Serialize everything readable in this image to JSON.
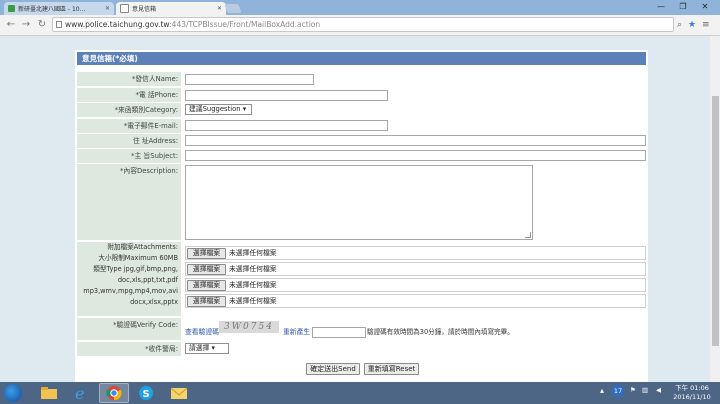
{
  "browser": {
    "tabs": [
      {
        "title": "新研臺北建八國區 - 10…",
        "active": false
      },
      {
        "title": "意見信箱",
        "active": true
      }
    ],
    "url_host": "www.police.taichung.gov.tw",
    "url_path": ":443/TCPBIssue/Front/MailBoxAdd.action",
    "window_controls": [
      "—",
      "❐",
      "✕"
    ]
  },
  "form": {
    "title": "意見信箱(*必填)",
    "fields": {
      "name_label": "*發信人Name:",
      "phone_label": "*電 話Phone:",
      "category_label": "*來函類別Category:",
      "category_value": "建議Suggestion ▾",
      "email_label": "*電子郵件E-mail:",
      "address_label": "住 址Address:",
      "subject_label": "*主 旨Subject:",
      "description_label": "*內容Description:"
    },
    "attachments": {
      "label": "附加檔案Attachments:",
      "max_size": "大小限制Maximum 60MB",
      "types_line1": "類型Type jpg,gif,bmp,png,",
      "types_line2": "doc,xls,ppt,txt,pdf",
      "types_line3": "mp3,wmv,mpg,mp4,mov,avi",
      "types_line4": "docx,xlsx,pptx",
      "choose_label": "選擇檔案",
      "no_file_label": "未選擇任何檔案"
    },
    "verify": {
      "label": "*驗證碼Verify Code:",
      "view_link": "查看驗證碼",
      "captcha_text": "3W0754",
      "refresh_link": "重新產生",
      "hint": "驗證碼有效時間為30分鐘，請於時間內填寫完畢。"
    },
    "recipient": {
      "label": "*收件警局:",
      "value": "請選擇 ▾"
    },
    "buttons": {
      "send": "確定送出Send",
      "reset": "重新填寫Reset"
    }
  },
  "taskbar": {
    "tray_lang": "17",
    "time": "下午 01:06",
    "date": "2016/11/10"
  },
  "colors": {
    "panel_header": "#5c80b8",
    "label_bg": "#dde8de",
    "page_bg": "#dfe9f0",
    "taskbar": "#4d6685"
  }
}
